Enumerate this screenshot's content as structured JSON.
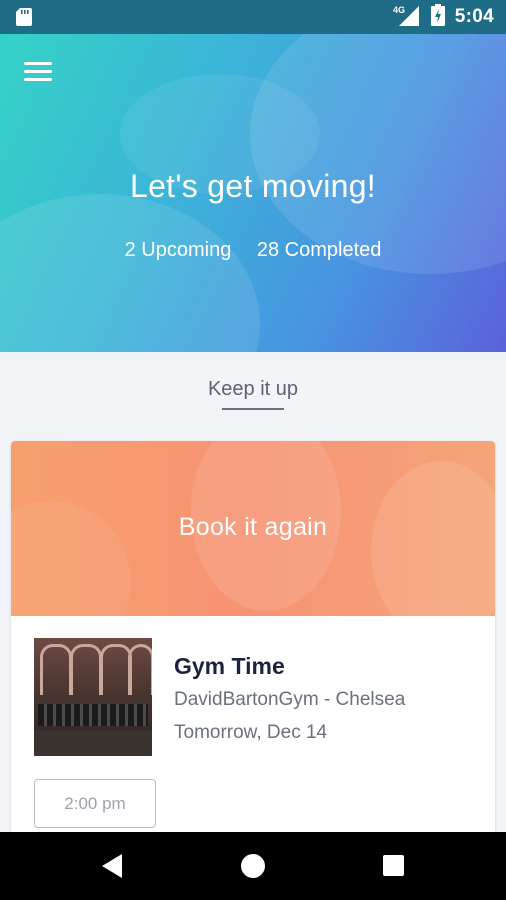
{
  "status_bar": {
    "time": "5:04",
    "network": "4G"
  },
  "hero": {
    "title": "Let's get moving!",
    "upcoming": "2 Upcoming",
    "completed": "28 Completed"
  },
  "section": {
    "title": "Keep it up"
  },
  "card": {
    "banner_title": "Book it again",
    "class_name": "Gym Time",
    "location": "DavidBartonGym - Chelsea",
    "date": "Tomorrow, Dec 14",
    "time_slot": "2:00 pm"
  },
  "icons": {
    "menu": "menu-icon",
    "sd_card": "sd-card-icon",
    "signal": "signal-icon",
    "battery": "battery-icon",
    "back": "back-icon",
    "home": "home-icon",
    "recents": "recents-icon"
  },
  "colors": {
    "hero_gradient_start": "#35d2c6",
    "hero_gradient_end": "#5b62da",
    "banner": "#f79373",
    "title_text": "#1c2340"
  }
}
